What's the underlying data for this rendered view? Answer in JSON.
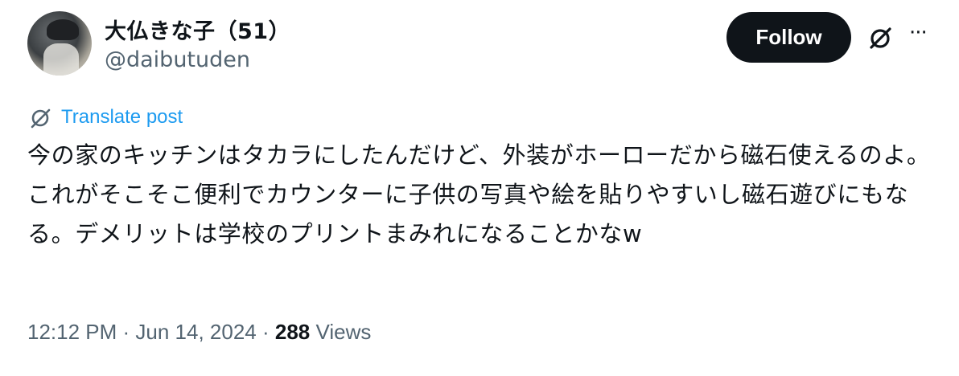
{
  "author": {
    "display_name": "大仏きな子（51）",
    "handle": "@daibutuden",
    "avatar_icon": "profile-photo-cyclist"
  },
  "actions": {
    "follow_label": "Follow",
    "grok_icon": "grok-icon",
    "more_icon": "more-icon",
    "more_glyph": "···"
  },
  "translate": {
    "icon": "globe-translate-icon",
    "label": "Translate post"
  },
  "tweet": {
    "text": "今の家のキッチンはタカラにしたんだけど、外装がホーローだから磁石使えるのよ。これがそこそこ便利でカウンターに子供の写真や絵を貼りやすいし磁石遊びにもなる。デメリットは学校のプリントまみれになることかなw"
  },
  "meta": {
    "time": "12:12 PM",
    "sep1": " · ",
    "date": "Jun 14, 2024",
    "sep2": " · ",
    "views_count": "288",
    "views_label": " Views"
  },
  "colors": {
    "text": "#0f1419",
    "secondary": "#536471",
    "link": "#1d9bf0",
    "button_bg": "#0f1419"
  }
}
